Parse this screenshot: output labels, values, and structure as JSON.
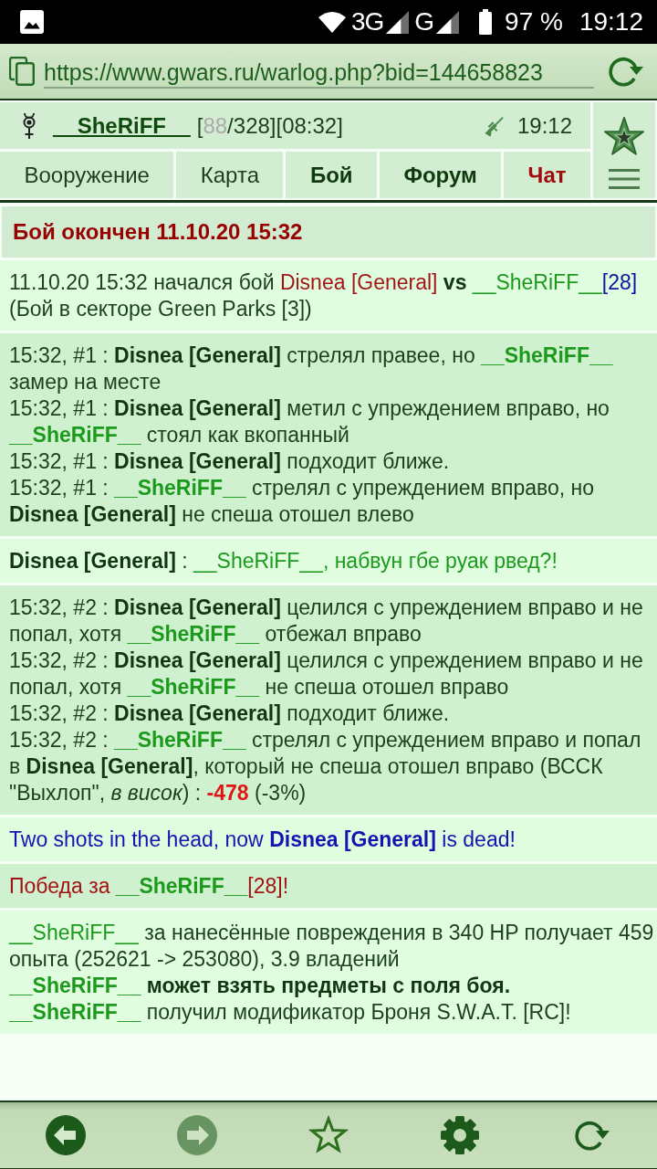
{
  "status_bar": {
    "networks": [
      {
        "label": "3G"
      },
      {
        "label": "G"
      }
    ],
    "battery": "97 %",
    "time": "19:12"
  },
  "address_bar": {
    "url": "https://www.gwars.ru/warlog.php?bid=144658823"
  },
  "header": {
    "username": "__SheRiFF__",
    "stats": [
      {
        "text": "[",
        "kind": "plain"
      },
      {
        "text": "88",
        "kind": "dim"
      },
      {
        "text": "/328][08:32]",
        "kind": "plain"
      }
    ],
    "time": "19:12",
    "tabs": [
      {
        "label": "Вооружение",
        "kind": "plain"
      },
      {
        "label": "Карта",
        "kind": "plain"
      },
      {
        "label": "Бой",
        "kind": "bold"
      },
      {
        "label": "Форум",
        "kind": "bold"
      },
      {
        "label": "Чат",
        "kind": "alert"
      }
    ]
  },
  "log": {
    "title": "Бой окончен 11.10.20 15:32",
    "blocks": [
      {
        "kind": "plain",
        "entries": [
          [
            {
              "text": "11.10.20 15:32 начался бой ",
              "kind": "plain"
            },
            {
              "text": "Disnea [General]",
              "kind": "enemy"
            },
            {
              "text": " vs ",
              "kind": "bold"
            },
            {
              "text": "__SheRiFF__",
              "kind": "herolight"
            },
            {
              "text": "[28]",
              "kind": "level"
            }
          ],
          [
            {
              "text": "(Бой в секторе Green Parks [3])",
              "kind": "plain"
            }
          ]
        ]
      },
      {
        "kind": "shaded",
        "entries": [
          [
            {
              "text": "15:32, #1 : ",
              "kind": "plain"
            },
            {
              "text": "Disnea [General]",
              "kind": "bold"
            },
            {
              "text": " стрелял правее, но ",
              "kind": "plain"
            },
            {
              "text": "__SheRiFF__",
              "kind": "hero"
            },
            {
              "text": " замер на месте",
              "kind": "plain"
            }
          ],
          [
            {
              "text": "15:32, #1 : ",
              "kind": "plain"
            },
            {
              "text": "Disnea [General]",
              "kind": "bold"
            },
            {
              "text": " метил с упреждением вправо, но ",
              "kind": "plain"
            },
            {
              "text": "__SheRiFF__",
              "kind": "hero"
            },
            {
              "text": " стоял как вкопанный",
              "kind": "plain"
            }
          ],
          [
            {
              "text": "15:32, #1 : ",
              "kind": "plain"
            },
            {
              "text": "Disnea [General]",
              "kind": "bold"
            },
            {
              "text": " подходит ближе.",
              "kind": "plain"
            }
          ],
          [
            {
              "text": "15:32, #1 : ",
              "kind": "plain"
            },
            {
              "text": "__SheRiFF__",
              "kind": "hero"
            },
            {
              "text": " стрелял с упреждением вправо, но ",
              "kind": "plain"
            },
            {
              "text": "Disnea [General]",
              "kind": "bold"
            },
            {
              "text": " не спеша отошел влево",
              "kind": "plain"
            }
          ]
        ]
      },
      {
        "kind": "plain",
        "entries": [
          [
            {
              "text": "Disnea [General]",
              "kind": "bold"
            },
            {
              "text": " : ",
              "kind": "plain"
            },
            {
              "text": "__SheRiFF__, набвун гбе руак рвед?!",
              "kind": "chat"
            }
          ]
        ]
      },
      {
        "kind": "shaded",
        "entries": [
          [
            {
              "text": "15:32, #2 : ",
              "kind": "plain"
            },
            {
              "text": "Disnea [General]",
              "kind": "bold"
            },
            {
              "text": " целился с упреждением вправо и не попал, хотя ",
              "kind": "plain"
            },
            {
              "text": "__SheRiFF__",
              "kind": "hero"
            },
            {
              "text": " отбежал вправо",
              "kind": "plain"
            }
          ],
          [
            {
              "text": "15:32, #2 : ",
              "kind": "plain"
            },
            {
              "text": "Disnea [General]",
              "kind": "bold"
            },
            {
              "text": " целился с упреждением вправо и не попал, хотя ",
              "kind": "plain"
            },
            {
              "text": "__SheRiFF__",
              "kind": "hero"
            },
            {
              "text": " не спеша отошел вправо",
              "kind": "plain"
            }
          ],
          [
            {
              "text": "15:32, #2 : ",
              "kind": "plain"
            },
            {
              "text": "Disnea [General]",
              "kind": "bold"
            },
            {
              "text": " подходит ближе.",
              "kind": "plain"
            }
          ],
          [
            {
              "text": "15:32, #2 : ",
              "kind": "plain"
            },
            {
              "text": "__SheRiFF__",
              "kind": "hero"
            },
            {
              "text": " стрелял с упреждением вправо и попал в ",
              "kind": "plain"
            },
            {
              "text": "Disnea [General]",
              "kind": "bold"
            },
            {
              "text": ", который не спеша отошел вправо (ВССК \"Выхлоп\", ",
              "kind": "plain"
            },
            {
              "text": "в висок",
              "kind": "italic"
            },
            {
              "text": ") : ",
              "kind": "plain"
            },
            {
              "text": "-478",
              "kind": "damage"
            },
            {
              "text": " (-3%)",
              "kind": "plain"
            }
          ]
        ]
      },
      {
        "kind": "plain",
        "entries": [
          [
            {
              "text": "Two shots in the head, now ",
              "kind": "news"
            },
            {
              "text": "Disnea [General]",
              "kind": "newsbold"
            },
            {
              "text": " is dead!",
              "kind": "news"
            }
          ]
        ]
      },
      {
        "kind": "shaded",
        "entries": [
          [
            {
              "text": "Победа за ",
              "kind": "win"
            },
            {
              "text": "__SheRiFF__",
              "kind": "hero"
            },
            {
              "text": "[28]!",
              "kind": "win"
            }
          ]
        ]
      },
      {
        "kind": "plain",
        "entries": [
          [
            {
              "text": "__SheRiFF__",
              "kind": "herolight"
            },
            {
              "text": " за нанесённые повреждения в 340 HP получает 459 опыта (252621 -> 253080), 3.9 владений",
              "kind": "plain"
            }
          ],
          [
            {
              "text": "__SheRiFF__",
              "kind": "hero"
            },
            {
              "text": " может взять предметы с поля боя.",
              "kind": "bold"
            }
          ],
          [
            {
              "text": "__SheRiFF__",
              "kind": "hero"
            },
            {
              "text": " получил модификатор Броня S.W.A.T. [RC]!",
              "kind": "plain"
            }
          ]
        ]
      }
    ]
  },
  "toolbar": [
    {
      "kind": "back",
      "disabled": false
    },
    {
      "kind": "forward",
      "disabled": true
    },
    {
      "kind": "bookmark",
      "disabled": false
    },
    {
      "kind": "settings",
      "disabled": false
    },
    {
      "kind": "reload",
      "disabled": false
    }
  ]
}
